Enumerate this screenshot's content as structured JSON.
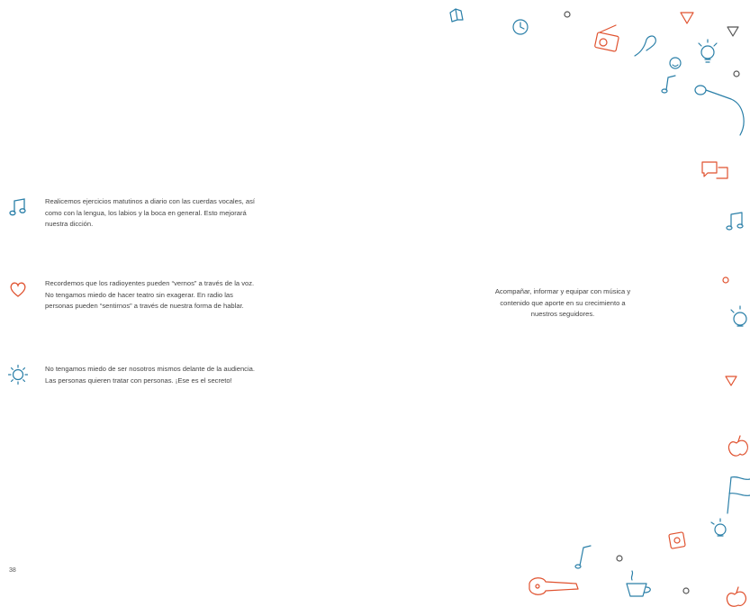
{
  "left_page": {
    "page_number": "38",
    "tips": [
      {
        "icon": "music-note-icon",
        "lines": [
          "Realicemos ejercicios matutinos a diario con las cuerdas vocales, así",
          "como con la lengua, los labios y la boca en general. Esto mejorará",
          "nuestra dicción."
        ]
      },
      {
        "icon": "heart-icon",
        "lines": [
          "Recordemos que los radioyentes pueden “vernos” a través de la voz.",
          "No tengamos miedo de hacer teatro sin exagerar. En radio las",
          "personas pueden “sentirnos” a través de nuestra forma de hablar."
        ]
      },
      {
        "icon": "sun-icon",
        "lines": [
          "No tengamos miedo de ser nosotros mismos delante de la audiencia.",
          "Las personas quieren tratar con personas. ¡Ese es el secreto!"
        ]
      }
    ]
  },
  "right_page": {
    "mission_lines": [
      "Acompañar, informar y equipar con música y",
      "contenido que aporte en su crecimiento a",
      "nuestros seguidores."
    ]
  },
  "colors": {
    "blue": "#2a7fa8",
    "orange": "#e0522f",
    "text": "#444444"
  }
}
